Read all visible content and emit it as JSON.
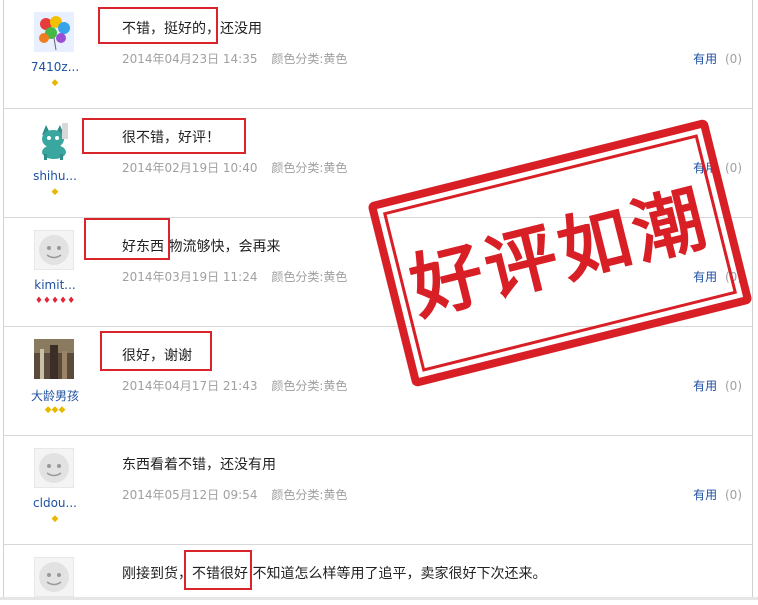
{
  "reviews": [
    {
      "username": "7410z...",
      "badges": "◆",
      "text": "不错，挺好的，还没用",
      "date": "2014年04月23日 14:35",
      "color": "颜色分类:黄色",
      "useful": "有用",
      "useful_count": "(0)"
    },
    {
      "username": "shihu...",
      "badges": "◆",
      "text": "很不错，好评！",
      "date": "2014年02月19日 10:40",
      "color": "颜色分类:黄色",
      "useful": "有用",
      "useful_count": "(0)"
    },
    {
      "username": "kimit...",
      "badges": "♦♦♦♦♦",
      "text": "好东西  物流够快，会再来",
      "date": "2014年03月19日 11:24",
      "color": "颜色分类:黄色",
      "useful": "有用",
      "useful_count": "(0)"
    },
    {
      "username": "大龄男孩",
      "badges": "◆◆◆",
      "text": "很好，谢谢",
      "date": "2014年04月17日 21:43",
      "color": "颜色分类:黄色",
      "useful": "有用",
      "useful_count": "(0)"
    },
    {
      "username": "cldou...",
      "badges": "◆",
      "text": "东西看着不错，还没有用",
      "date": "2014年05月12日 09:54",
      "color": "颜色分类:黄色",
      "useful": "有用",
      "useful_count": "(0)"
    },
    {
      "text": "刚接到货，不错很好 不知道怎么样等用了追平，卖家很好下次还来。"
    }
  ],
  "stamp": {
    "text": "好评如潮",
    "color": "#d81f26"
  },
  "colors": {
    "highlight": "#d9242b",
    "username": "#1e50a2",
    "meta": "#a0a0a0"
  }
}
